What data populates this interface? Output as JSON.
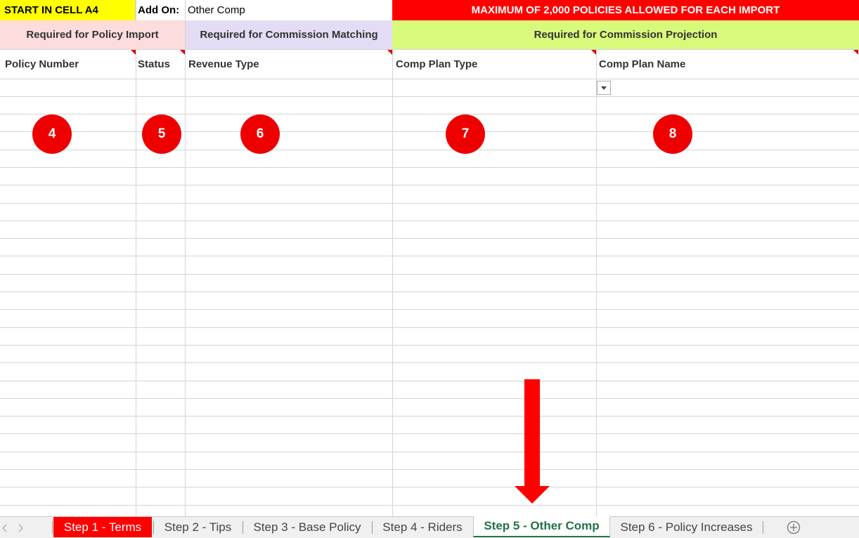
{
  "header": {
    "start_cell": "START IN CELL A4",
    "add_on_label": "Add On:",
    "add_on_value": "Other Comp",
    "max_notice": "MAXIMUM OF 2,000 POLICIES ALLOWED FOR EACH IMPORT"
  },
  "groups": {
    "policy_import": "Required for Policy Import",
    "commission_matching": "Required for Commission Matching",
    "commission_projection": "Required for Commission Projection"
  },
  "columns": [
    "Policy Number",
    "Status",
    "Revenue Type",
    "Comp Plan Type",
    "Comp Plan Name"
  ],
  "markers": [
    "4",
    "5",
    "6",
    "7",
    "8"
  ],
  "sheet_tabs": [
    "Step 1 - Terms",
    "Step 2 - Tips",
    "Step 3 - Base Policy",
    "Step 4 - Riders",
    "Step 5 - Other Comp",
    "Step 6 - Policy Increases"
  ],
  "active_tab": "Step 5 - Other Comp",
  "colors": {
    "yellow": "#ffff00",
    "red": "#ff0000",
    "pink": "#fcdcdc",
    "lavender": "#e4dcf4",
    "lime": "#d8f97a",
    "active_tab_text": "#217346"
  },
  "icons": [
    "dropdown-arrow-icon",
    "add-sheet-icon",
    "scroll-left-icon",
    "scroll-right-icon",
    "arrow-down-icon"
  ]
}
